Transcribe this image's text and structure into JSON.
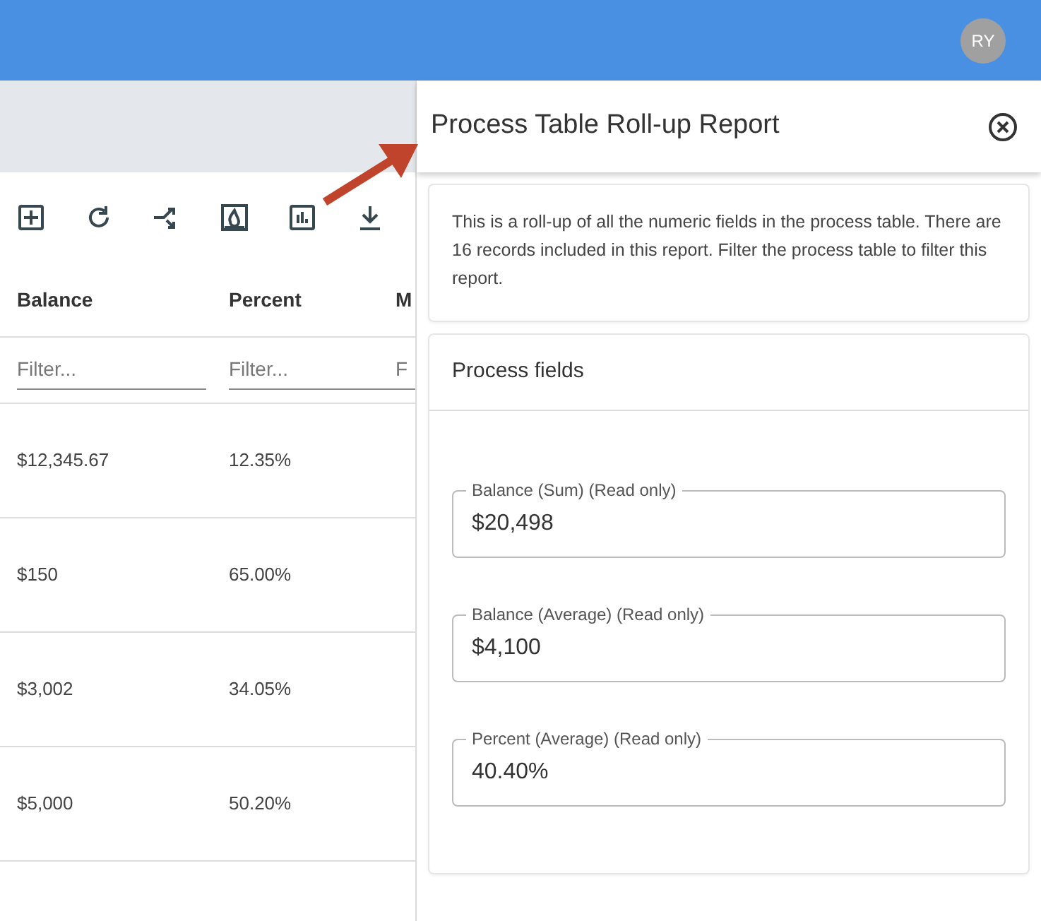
{
  "user": {
    "initials": "RY"
  },
  "toolbar": [
    {
      "kind": "add"
    },
    {
      "kind": "refresh"
    },
    {
      "kind": "shuffle"
    },
    {
      "kind": "fire"
    },
    {
      "kind": "chart"
    },
    {
      "kind": "download"
    }
  ],
  "table": {
    "columns": [
      {
        "label": "Balance",
        "filter_placeholder": "Filter..."
      },
      {
        "label": "Percent",
        "filter_placeholder": "Filter..."
      },
      {
        "label": "M",
        "filter_placeholder": "F"
      }
    ],
    "rows": [
      [
        "$12,345.67",
        "12.35%"
      ],
      [
        "$150",
        "65.00%"
      ],
      [
        "$3,002",
        "34.05%"
      ],
      [
        "$5,000",
        "50.20%"
      ]
    ]
  },
  "panel": {
    "title": "Process Table Roll-up Report",
    "description": "This is a roll-up of all the numeric fields in the process table. There are 16 records included in this report. Filter the process table to filter this report.",
    "section_title": "Process fields",
    "fields": [
      {
        "label": "Balance (Sum) (Read only)",
        "value": "$20,498"
      },
      {
        "label": "Balance (Average) (Read only)",
        "value": "$4,100"
      },
      {
        "label": "Percent (Average) (Read only)",
        "value": "40.40%"
      }
    ]
  }
}
